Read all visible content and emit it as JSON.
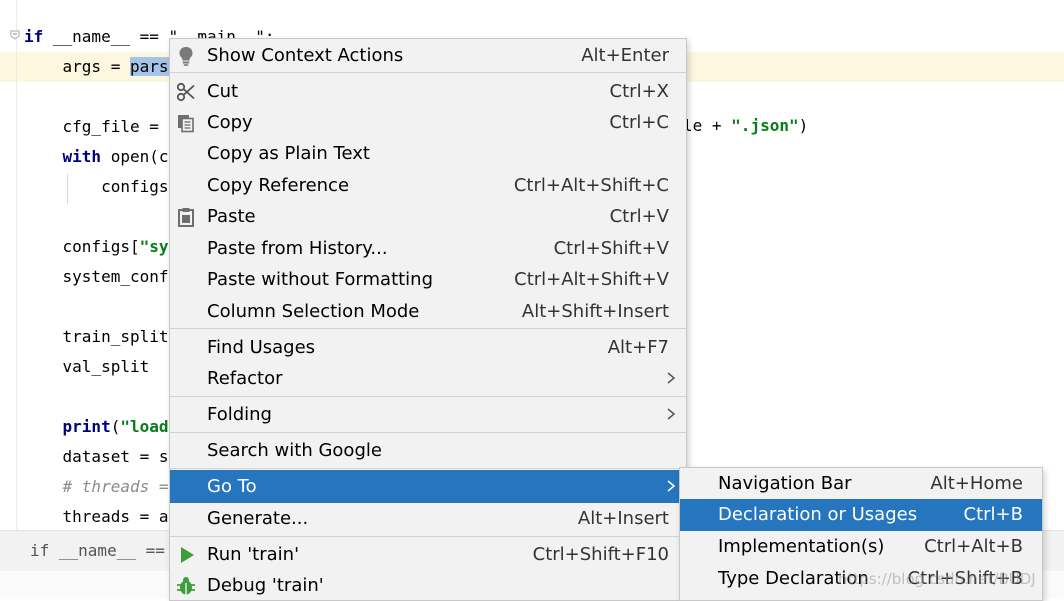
{
  "editor": {
    "lines": [
      {
        "parts": [
          {
            "t": "if",
            "c": "kw"
          },
          {
            "t": " __name__ == \"__main__\":",
            "c": ""
          }
        ]
      },
      {
        "parts": [
          {
            "t": "    args = ",
            "c": ""
          },
          {
            "t": "pars",
            "c": "sel"
          }
        ]
      },
      {
        "parts": [
          {
            "t": "",
            "c": ""
          }
        ]
      },
      {
        "parts": [
          {
            "t": "    cfg_file = ",
            "c": ""
          }
        ]
      },
      {
        "parts": [
          {
            "t": "    ",
            "c": ""
          },
          {
            "t": "with",
            "c": "kw"
          },
          {
            "t": " open(c",
            "c": ""
          }
        ]
      },
      {
        "parts": [
          {
            "t": "        configs",
            "c": ""
          }
        ]
      },
      {
        "parts": [
          {
            "t": "",
            "c": ""
          }
        ]
      },
      {
        "parts": [
          {
            "t": "    configs[",
            "c": ""
          },
          {
            "t": "\"sy",
            "c": "str"
          }
        ]
      },
      {
        "parts": [
          {
            "t": "    system_conf",
            "c": ""
          }
        ]
      },
      {
        "parts": [
          {
            "t": "",
            "c": ""
          }
        ]
      },
      {
        "parts": [
          {
            "t": "    train_split",
            "c": ""
          }
        ]
      },
      {
        "parts": [
          {
            "t": "    val_split",
            "c": ""
          }
        ]
      },
      {
        "parts": [
          {
            "t": "",
            "c": ""
          }
        ]
      },
      {
        "parts": [
          {
            "t": "    ",
            "c": ""
          },
          {
            "t": "print",
            "c": "kw"
          },
          {
            "t": "(",
            "c": ""
          },
          {
            "t": "\"load",
            "c": "str"
          }
        ]
      },
      {
        "parts": [
          {
            "t": "    dataset = s",
            "c": ""
          }
        ]
      },
      {
        "parts": [
          {
            "t": "    # threads =",
            "c": "cmt"
          }
        ]
      },
      {
        "parts": [
          {
            "t": "    threads = a",
            "c": ""
          }
        ]
      }
    ],
    "right_fragment": [
      {
        "t": "le + ",
        "c": ""
      },
      {
        "t": "\".json\"",
        "c": "str"
      },
      {
        "t": ")",
        "c": ""
      }
    ]
  },
  "breadcrumb": {
    "text": "if __name__ == \""
  },
  "context_menu": {
    "items": [
      {
        "label": "Show Context Actions",
        "shortcut": "Alt+Enter",
        "icon": "lightbulb-icon"
      },
      {
        "label": "Cut",
        "shortcut": "Ctrl+X",
        "icon": "scissors-icon"
      },
      {
        "label": "Copy",
        "shortcut": "Ctrl+C",
        "icon": "copy-icon"
      },
      {
        "label": "Copy as Plain Text",
        "shortcut": "",
        "icon": ""
      },
      {
        "label": "Copy Reference",
        "shortcut": "Ctrl+Alt+Shift+C",
        "icon": ""
      },
      {
        "label": "Paste",
        "shortcut": "Ctrl+V",
        "icon": "clipboard-icon"
      },
      {
        "label": "Paste from History...",
        "shortcut": "Ctrl+Shift+V",
        "icon": ""
      },
      {
        "label": "Paste without Formatting",
        "shortcut": "Ctrl+Alt+Shift+V",
        "icon": ""
      },
      {
        "label": "Column Selection Mode",
        "shortcut": "Alt+Shift+Insert",
        "icon": ""
      },
      {
        "label": "Find Usages",
        "shortcut": "Alt+F7",
        "icon": ""
      },
      {
        "label": "Refactor",
        "shortcut": "",
        "icon": "",
        "submenu": true
      },
      {
        "label": "Folding",
        "shortcut": "",
        "icon": "",
        "submenu": true
      },
      {
        "label": "Search with Google",
        "shortcut": "",
        "icon": ""
      },
      {
        "label": "Go To",
        "shortcut": "",
        "icon": "",
        "submenu": true,
        "active": true
      },
      {
        "label": "Generate...",
        "shortcut": "Alt+Insert",
        "icon": ""
      },
      {
        "label": "Run 'train'",
        "shortcut": "Ctrl+Shift+F10",
        "icon": "run-icon"
      },
      {
        "label": "Debug 'train'",
        "shortcut": "",
        "icon": "debug-icon"
      }
    ]
  },
  "submenu": {
    "items": [
      {
        "label": "Navigation Bar",
        "shortcut": "Alt+Home"
      },
      {
        "label": "Declaration or Usages",
        "shortcut": "Ctrl+B",
        "active": true
      },
      {
        "label": "Implementation(s)",
        "shortcut": "Ctrl+Alt+B"
      },
      {
        "label": "Type Declaration",
        "shortcut": "Ctrl+Shift+B"
      }
    ]
  },
  "watermark": "https://blog.csdn.net/BUDJ",
  "colors": {
    "selection": "#2675bf",
    "menu_bg": "#f2f2f2",
    "keyword": "#000080",
    "string": "#067d17"
  }
}
